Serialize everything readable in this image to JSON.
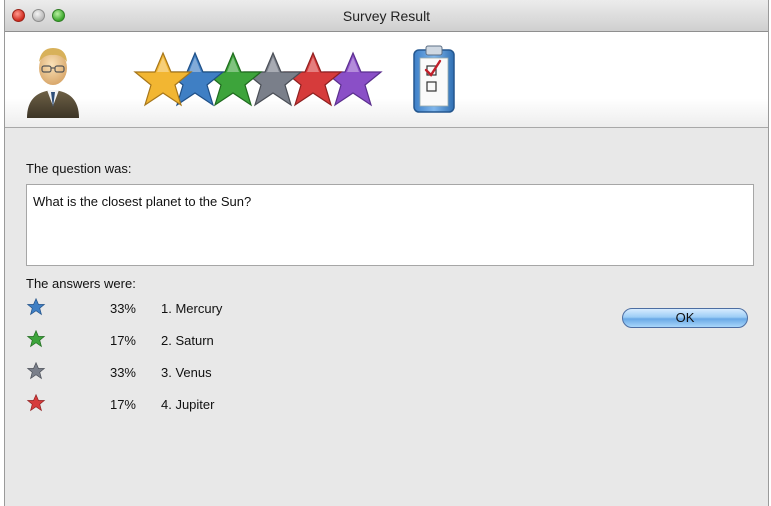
{
  "window": {
    "title": "Survey Result"
  },
  "banner": {
    "icons": [
      "user-avatar-icon",
      "rating-stars-icon",
      "checklist-clipboard-icon"
    ],
    "star_colors": [
      "#f2b632",
      "#3f7fc4",
      "#3da43b",
      "#7a7f8a",
      "#d63b3b",
      "#8a4fc7"
    ]
  },
  "question": {
    "heading": "The question was:",
    "text": "What is the closest planet to the Sun?"
  },
  "answers": {
    "heading": "The answers were:",
    "rows": [
      {
        "icon": "blue-star-icon",
        "color": "#3f7fc4",
        "percent": "33%",
        "label": "1. Mercury"
      },
      {
        "icon": "green-star-icon",
        "color": "#3da43b",
        "percent": "17%",
        "label": "2. Saturn"
      },
      {
        "icon": "gray-star-icon",
        "color": "#7a7f8a",
        "percent": "33%",
        "label": "3. Venus"
      },
      {
        "icon": "red-star-icon",
        "color": "#d63b3b",
        "percent": "17%",
        "label": "4. Jupiter"
      }
    ]
  },
  "buttons": {
    "ok_label": "OK"
  }
}
